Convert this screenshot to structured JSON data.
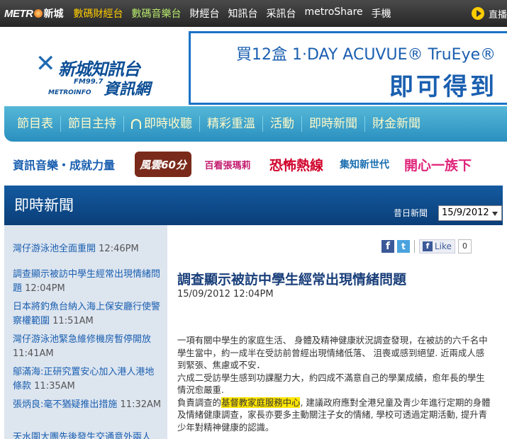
{
  "topbar": {
    "brand_en": "METR",
    "brand_zh": "新城",
    "nav": [
      "數碼財經台",
      "數碼音樂台",
      "財經台",
      "知訊台",
      "采訊台",
      "metroShare",
      "手機"
    ],
    "live_label": "直播"
  },
  "header": {
    "logo_zh_top": "新城知訊台",
    "logo_fm": "FM99.7",
    "logo_zh_bottom": "資訊網",
    "logo_en": "METROINFO",
    "ad_line1": "買12盒 1·DAY ACUVUE® TruEye®",
    "ad_line2": "即可得到"
  },
  "mainnav": [
    "節目表",
    "節目主持",
    "即時收聽",
    "精彩重溫",
    "活動",
    "即時新聞",
    "財金新聞"
  ],
  "programs": {
    "slogan": "資訊音樂・成就力量",
    "items": [
      "風雲60分",
      "百看張瑪莉",
      "恐怖熱線",
      "集知新世代",
      "開心一族下"
    ]
  },
  "section": {
    "title": "即時新聞",
    "past_label": "昔日新聞",
    "date_value": "15/9/2012"
  },
  "sidebar": {
    "items": [
      {
        "headline": "灣仔游泳池全面重開",
        "time": "12:46PM"
      },
      {
        "headline": "調查顯示被訪中學生經常出現情緒問題",
        "time": "12:04PM"
      },
      {
        "headline": "日本將釣魚台納入海上保安廳行使警察權範圍",
        "time": "11:51AM"
      },
      {
        "headline": "灣仔游泳池緊急維修機房暫停開放",
        "time": "11:41AM"
      },
      {
        "headline": "鄔滿海:正研究置安心加入港人港地條款",
        "time": "11:35AM"
      },
      {
        "headline": "張炳良:毫不猶疑推出措施",
        "time": "11:32AM"
      },
      {
        "headline": "天水圍大團先後發生交通意外兩人",
        "time": ""
      }
    ]
  },
  "article": {
    "like_label": "Like",
    "like_count": "0",
    "title": "調查顯示被訪中學生經常出現情緒問題",
    "date": "15/09/2012 12:04PM",
    "para1": "一項有關中學生的家庭生活、 身體及精神健康狀況調查發現，在被訪的六千名中學生當中，約一成半在受訪前曾經出現情緒低落、 沮喪或感到絕望. 近兩成人感到緊張、焦慮或不安．",
    "para2": "六成二受訪學生感到功課壓力大，約四成不滿意自己的學業成績，愈年長的學生情況愈嚴重.",
    "para3_pre": "負責調查的",
    "para3_hl": "基督教家庭服務中心",
    "para3_post": ", 建議政府應對全港兒童及青少年進行定期的身體及情緒健康調查，家長亦要多主動關注子女的情緒, 學校可透過定期活動, 提升青少年對精神健康的認識。"
  },
  "colors": {
    "topbar": "#333333",
    "nav_blue": "#2a8fbf",
    "section_blue": "#0a3e78",
    "sidebar_bg": "#dde5ef",
    "link_blue": "#1a5fb0",
    "title_blue": "#1a3f7a",
    "highlight": "#ffe600"
  }
}
